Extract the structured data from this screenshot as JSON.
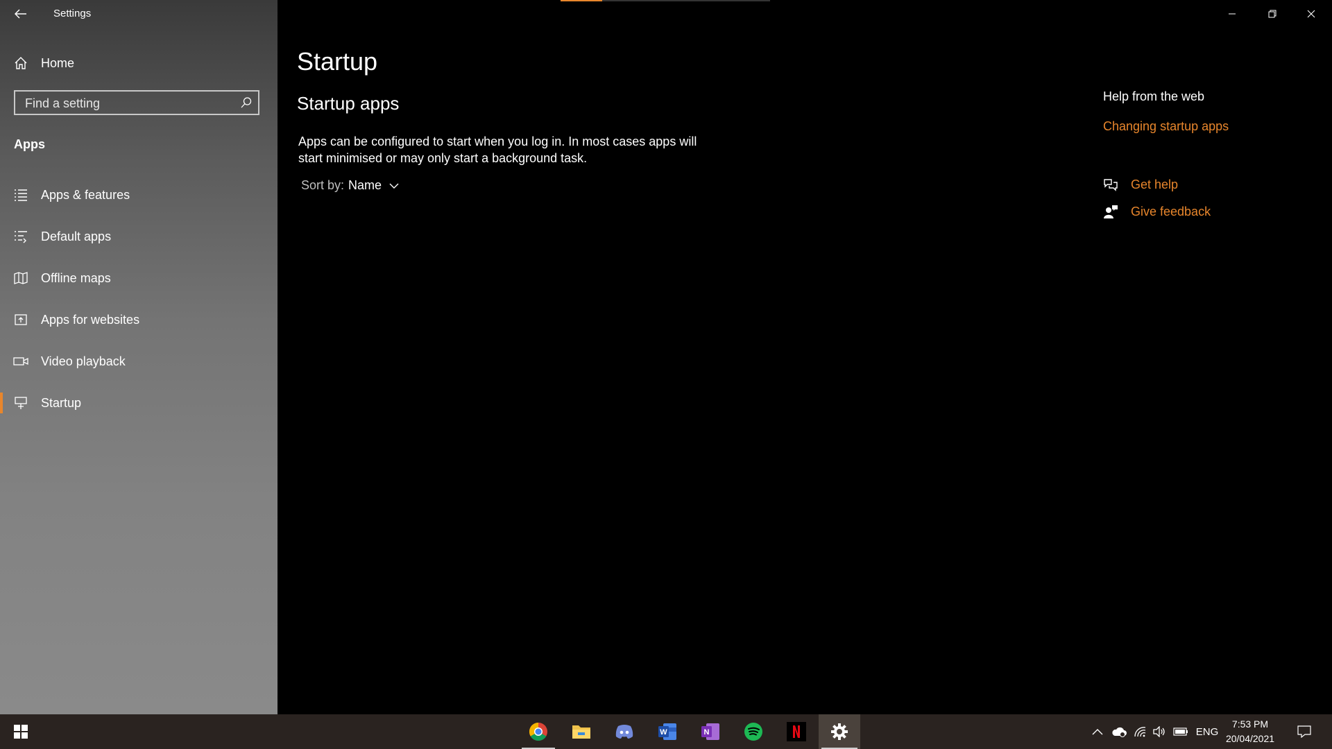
{
  "window": {
    "app_title": "Settings"
  },
  "sidebar": {
    "home_label": "Home",
    "search_placeholder": "Find a setting",
    "section_label": "Apps",
    "items": [
      {
        "label": "Apps & features",
        "icon": "list-icon",
        "active": false
      },
      {
        "label": "Default apps",
        "icon": "default-apps-icon",
        "active": false
      },
      {
        "label": "Offline maps",
        "icon": "map-icon",
        "active": false
      },
      {
        "label": "Apps for websites",
        "icon": "open-external-icon",
        "active": false
      },
      {
        "label": "Video playback",
        "icon": "video-icon",
        "active": false
      },
      {
        "label": "Startup",
        "icon": "startup-icon",
        "active": true
      }
    ]
  },
  "main": {
    "title": "Startup",
    "subtitle": "Startup apps",
    "description": "Apps can be configured to start when you log in. In most cases apps will start minimised or may only start a background task.",
    "sort_label": "Sort by:",
    "sort_value": "Name"
  },
  "help": {
    "heading": "Help from the web",
    "link": "Changing startup apps",
    "get_help": "Get help",
    "give_feedback": "Give feedback"
  },
  "taskbar": {
    "apps": [
      "chrome-icon",
      "file-explorer-icon",
      "discord-icon",
      "word-icon",
      "onenote-icon",
      "spotify-icon",
      "netflix-icon",
      "settings-gear-icon"
    ],
    "language": "ENG",
    "time": "7:53 PM",
    "date": "20/04/2021"
  },
  "colors": {
    "accent": "#e8862c",
    "taskbar": "#2a2320",
    "background": "#000000"
  }
}
